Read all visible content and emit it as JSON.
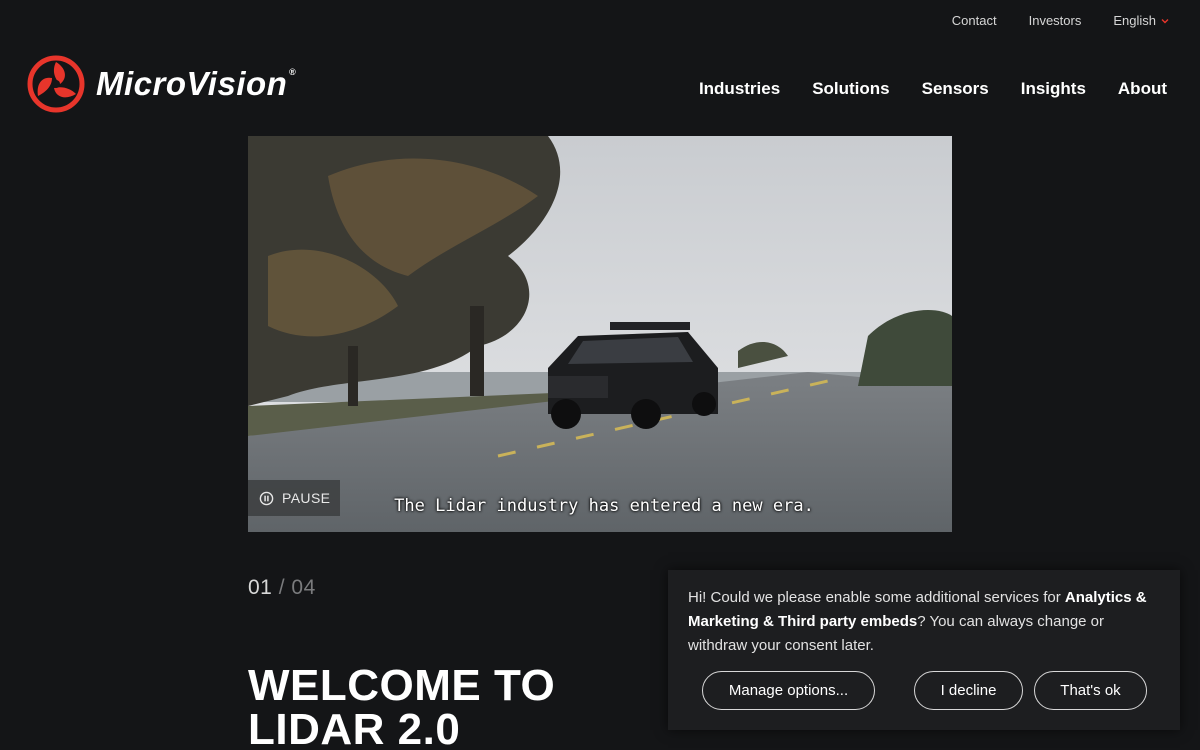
{
  "utility_nav": {
    "contact": "Contact",
    "investors": "Investors",
    "language": "English"
  },
  "logo": {
    "text": "MicroVision",
    "registered": "®"
  },
  "main_nav": {
    "items": [
      "Industries",
      "Solutions",
      "Sensors",
      "Insights",
      "About"
    ]
  },
  "hero": {
    "pause_label": "PAUSE",
    "caption": "The Lidar industry has entered a new era."
  },
  "slider": {
    "current": "01",
    "separator": "/",
    "total": "04"
  },
  "headline": {
    "line1": "WELCOME TO",
    "line2": "LIDAR 2.0"
  },
  "cookie_banner": {
    "text_before": "Hi! Could we please enable some additional services for ",
    "text_bold": "Analytics & Marketing & Third party embeds",
    "text_after": "? You can always change or withdraw your consent later.",
    "manage_label": "Manage options...",
    "decline_label": "I decline",
    "accept_label": "That's ok"
  },
  "colors": {
    "background": "#141517",
    "brand_red": "#e8352b",
    "cookie_bg": "#1d1e20"
  }
}
